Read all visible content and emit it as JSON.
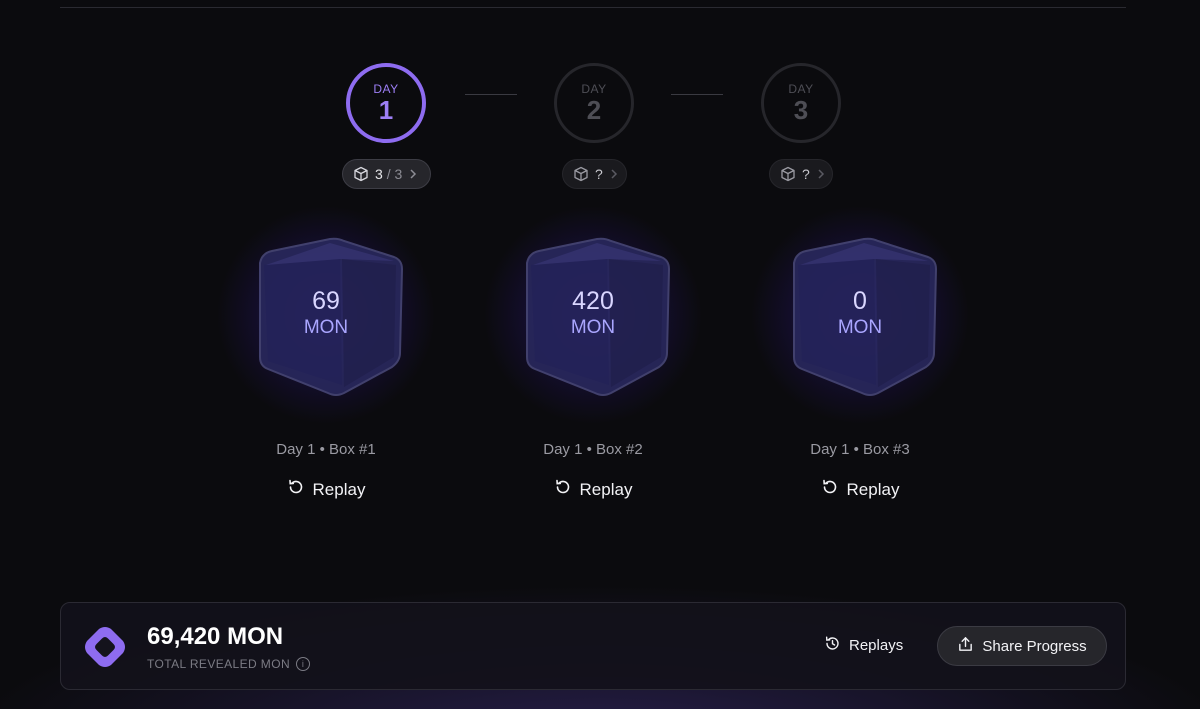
{
  "days": [
    {
      "label": "DAY",
      "number": "1",
      "state": "active",
      "pill": {
        "count": "3",
        "separator": "/",
        "total": "3"
      }
    },
    {
      "label": "DAY",
      "number": "2",
      "state": "inactive",
      "pill": {
        "count": "?"
      }
    },
    {
      "label": "DAY",
      "number": "3",
      "state": "inactive",
      "pill": {
        "count": "?"
      }
    }
  ],
  "boxes": [
    {
      "value": "69",
      "unit": "MON",
      "caption": "Day 1 • Box #1",
      "replay_label": "Replay"
    },
    {
      "value": "420",
      "unit": "MON",
      "caption": "Day 1 • Box #2",
      "replay_label": "Replay"
    },
    {
      "value": "0",
      "unit": "MON",
      "caption": "Day 1 • Box #3",
      "replay_label": "Replay"
    }
  ],
  "summary": {
    "total_value": "69,420 MON",
    "total_label": "TOTAL REVEALED MON",
    "replays_label": "Replays",
    "share_label": "Share Progress"
  },
  "colors": {
    "accent": "#8e6cf0",
    "background": "#0b0b0e",
    "box_glow": "#4628c8"
  },
  "icons": [
    "cube-icon",
    "chevron-right-icon",
    "replay-icon",
    "history-icon",
    "share-icon",
    "logo-icon",
    "info-icon"
  ]
}
